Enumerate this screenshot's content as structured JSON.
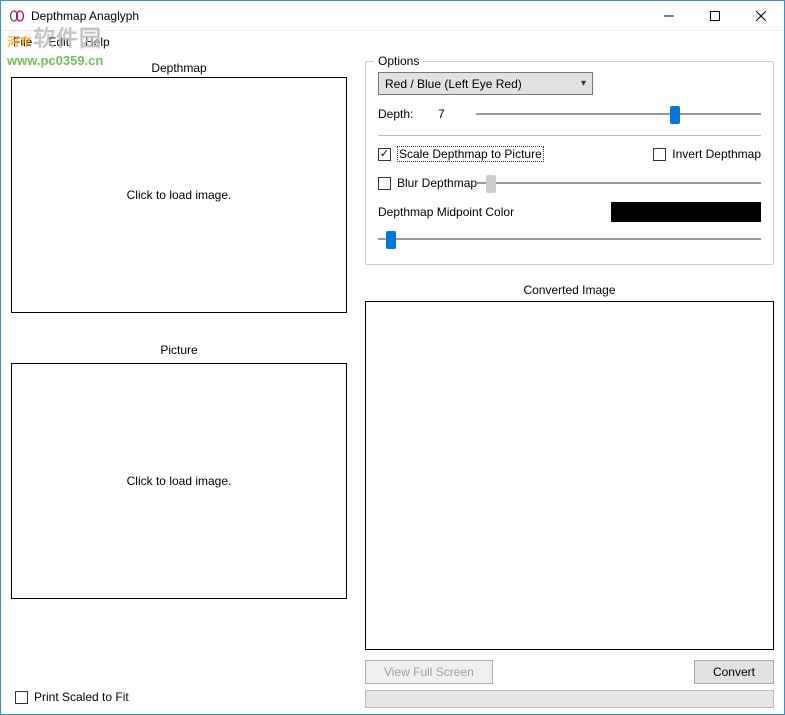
{
  "window": {
    "title": "Depthmap Anaglyph"
  },
  "menu": {
    "file": "File",
    "edit": "Edit",
    "help": "Help"
  },
  "watermark": {
    "title": "河东软件园",
    "url": "www.pc0359.cn"
  },
  "panels": {
    "depthmap": "Depthmap",
    "picture": "Picture",
    "converted": "Converted Image",
    "load_prompt": "Click to load image."
  },
  "options": {
    "legend": "Options",
    "mode_selected": "Red / Blue (Left Eye Red)",
    "depth_label": "Depth:",
    "depth_value": "7",
    "scale_label": "Scale Depthmap to Picture",
    "scale_checked": true,
    "invert_label": "Invert Depthmap",
    "invert_checked": false,
    "blur_label": "Blur Depthmap",
    "blur_checked": false,
    "midpoint_label": "Depthmap Midpoint Color",
    "midpoint_color": "#000000"
  },
  "buttons": {
    "view_full": "View Full Screen",
    "convert": "Convert"
  },
  "footer": {
    "print_scaled": "Print Scaled to Fit",
    "print_scaled_checked": false
  }
}
